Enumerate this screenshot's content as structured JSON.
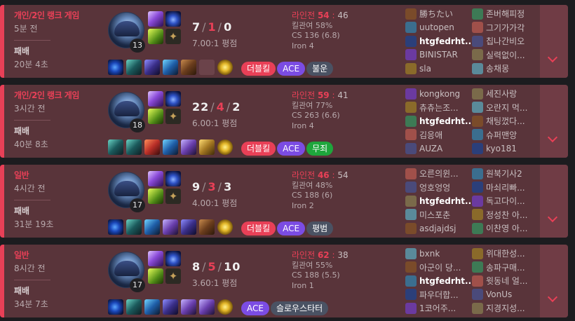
{
  "matches": [
    {
      "queue": "개인/2인 랭크 게임",
      "time_ago": "5분 전",
      "result": "패배",
      "duration": "20분 4초",
      "level": "13",
      "kda": {
        "k": "7",
        "d": "1",
        "a": "0"
      },
      "ratio": "7.00:1 평점",
      "stats": {
        "lane_label": "라인전",
        "lane_win": "54",
        "lane_lose": "46",
        "kp": "킬관여 58%",
        "cs": "CS 136 (6.8)",
        "tier": "Iron 4"
      },
      "items": [
        "it1",
        "it2",
        "it3",
        "it4",
        "it5",
        "empty",
        "ward"
      ],
      "tags": [
        {
          "label": "더블킬",
          "style": "red"
        },
        {
          "label": "ACE",
          "style": "ace"
        },
        {
          "label": "불운",
          "style": "gray"
        }
      ],
      "team1": [
        "勝ちたい",
        "uutopen",
        "htgfedrht...",
        "BINISTAR",
        "sla"
      ],
      "team2": [
        "존버해피정",
        "그기가가각",
        "칩나간비오",
        "실력없이...",
        "송채몽"
      ]
    },
    {
      "queue": "개인/2인 랭크 게임",
      "time_ago": "3시간 전",
      "result": "패배",
      "duration": "40분 8초",
      "level": "18",
      "kda": {
        "k": "22",
        "d": "4",
        "a": "2"
      },
      "ratio": "6.00:1 평점",
      "stats": {
        "lane_label": "라인전",
        "lane_win": "59",
        "lane_lose": "41",
        "kp": "킬관여 77%",
        "cs": "CS 263 (6.6)",
        "tier": "Iron 4"
      },
      "items": [
        "it2",
        "it2",
        "it6",
        "it4",
        "it8",
        "it7",
        "ward"
      ],
      "tags": [
        {
          "label": "더블킬",
          "style": "red"
        },
        {
          "label": "ACE",
          "style": "ace"
        },
        {
          "label": "무죄",
          "style": "green"
        }
      ],
      "team1": [
        "kongkong",
        "츄츄는조...",
        "htgfedrht...",
        "김응애",
        "AUZA"
      ],
      "team2": [
        "세진사랑",
        "오란지 먹...",
        "채팅껐다...",
        "슈퍼맨앙",
        "kyo181"
      ]
    },
    {
      "queue": "일반",
      "time_ago": "4시간 전",
      "result": "패배",
      "duration": "31분 19초",
      "level": "17",
      "kda": {
        "k": "9",
        "d": "3",
        "a": "3"
      },
      "ratio": "4.00:1 평점",
      "stats": {
        "lane_label": "라인전",
        "lane_win": "46",
        "lane_lose": "54",
        "kp": "킬관여 48%",
        "cs": "CS 188 (6)",
        "tier": "Iron 2"
      },
      "items": [
        "it1",
        "it2",
        "it4",
        "it8",
        "it3",
        "it5",
        "ward"
      ],
      "tags": [
        {
          "label": "더블킬",
          "style": "red"
        },
        {
          "label": "ACE",
          "style": "ace"
        },
        {
          "label": "평범",
          "style": "gray"
        }
      ],
      "team1": [
        "오른의윈...",
        "엉호엉엉",
        "htgfedrht...",
        "미스포춘",
        "asdjajdsj"
      ],
      "team2": [
        "원북기사2",
        "마쇠리빠...",
        "독고다이...",
        "정성찬 아...",
        "이찬영 아..."
      ]
    },
    {
      "queue": "일반",
      "time_ago": "8시간 전",
      "result": "패배",
      "duration": "34분 7초",
      "level": "17",
      "kda": {
        "k": "8",
        "d": "5",
        "a": "10"
      },
      "ratio": "3.60:1 평점",
      "stats": {
        "lane_label": "라인전",
        "lane_win": "62",
        "lane_lose": "38",
        "kp": "킬관여 55%",
        "cs": "CS 188 (5.5)",
        "tier": "Iron 1"
      },
      "items": [
        "it1",
        "it2",
        "it4",
        "it3",
        "it8",
        "it8",
        "ward"
      ],
      "tags": [
        {
          "label": "ACE",
          "style": "ace"
        },
        {
          "label": "슬로우스타터",
          "style": "gray"
        }
      ],
      "team1": [
        "bxnk",
        "아군이 당...",
        "htgfedrht...",
        "파우더합...",
        "1코어주..."
      ],
      "team2": [
        "위대한성...",
        "송파구매...",
        "윗동네 얼...",
        "VonUs",
        "지경지성..."
      ]
    }
  ],
  "colors": {
    "loss_bg": "#59343a",
    "loss_accent": "#e84057",
    "ace": "#7b4ce3",
    "tag_gray": "#4a5263",
    "tag_green": "#1ea63c"
  }
}
